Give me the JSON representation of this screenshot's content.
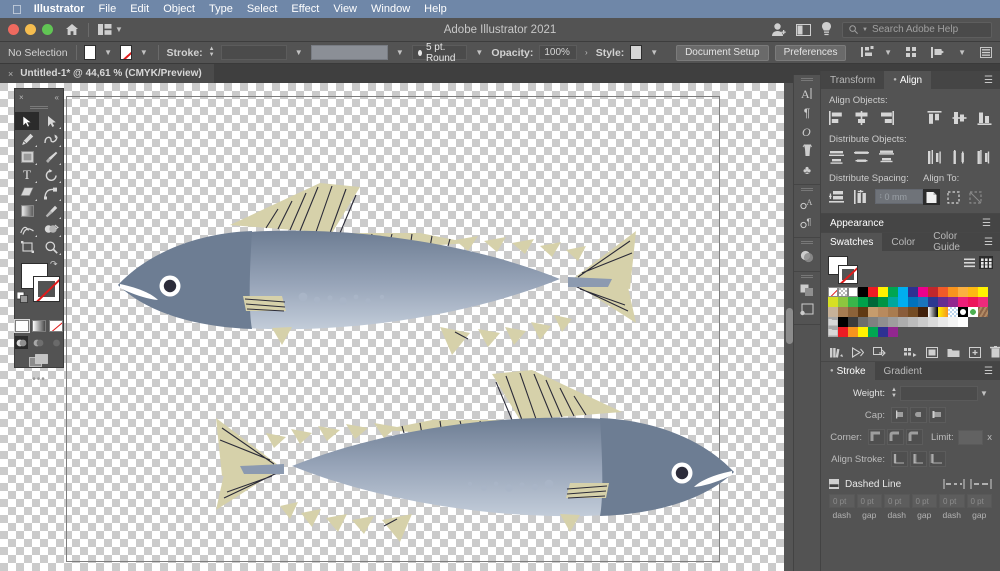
{
  "menubar": {
    "apple": "apple-logo",
    "app": "Illustrator",
    "items": [
      "File",
      "Edit",
      "Object",
      "Type",
      "Select",
      "Effect",
      "View",
      "Window",
      "Help"
    ]
  },
  "titlebar": {
    "title": "Adobe Illustrator 2021",
    "search_placeholder": "Search Adobe Help",
    "home_icon": "home-icon",
    "layout_icon": "arrange-documents-icon",
    "account_icon": "user-account-icon",
    "panel_icon": "panel-toggle-icon",
    "bulb_icon": "discover-bulb-icon"
  },
  "control_bar": {
    "selection_state": "No Selection",
    "fill_label": "fill-swatch",
    "stroke_label": "Stroke:",
    "stroke_weight": "",
    "stroke_profile": "",
    "brush_def": "5 pt. Round",
    "opacity_label": "Opacity:",
    "opacity_value": "100%",
    "style_label": "Style:",
    "document_setup": "Document Setup",
    "preferences": "Preferences",
    "align_icon": "align-options-icon"
  },
  "doc_tab": {
    "close": "×",
    "title": "Untitled-1* @ 44,61 % (CMYK/Preview)"
  },
  "toolbar": {
    "close": "×",
    "collapse": "«",
    "tools": [
      {
        "name": "selection-tool",
        "glyph": "selection-arrow",
        "active": true
      },
      {
        "name": "direct-selection-tool",
        "glyph": "direct-arrow",
        "active": false
      },
      {
        "name": "pen-tool",
        "glyph": "pen",
        "active": false
      },
      {
        "name": "curvature-tool",
        "glyph": "curvature",
        "active": false
      },
      {
        "name": "rectangle-tool",
        "glyph": "rectangle",
        "active": false
      },
      {
        "name": "paintbrush-tool",
        "glyph": "brush",
        "active": false
      },
      {
        "name": "type-tool",
        "glyph": "T",
        "active": false
      },
      {
        "name": "rotate-tool",
        "glyph": "rotate",
        "active": false
      },
      {
        "name": "eraser-tool",
        "glyph": "eraser",
        "active": false
      },
      {
        "name": "scale-tool",
        "glyph": "scale",
        "active": false
      },
      {
        "name": "gradient-tool",
        "glyph": "gradient",
        "active": false
      },
      {
        "name": "eyedropper-tool",
        "glyph": "eyedropper",
        "active": false
      },
      {
        "name": "blend-tool",
        "glyph": "blend",
        "active": false
      },
      {
        "name": "shape-builder-tool",
        "glyph": "shapebuilder",
        "active": false
      },
      {
        "name": "artboard-tool",
        "glyph": "artboard",
        "active": false
      },
      {
        "name": "zoom-tool",
        "glyph": "magnifier",
        "active": false
      }
    ],
    "fill_color": "#ffffff",
    "stroke_color": "none",
    "swap_icon": "swap-fill-stroke-icon",
    "default_icon": "default-fill-stroke-icon",
    "mini_modes": [
      "color-fill",
      "gradient-fill",
      "none-fill"
    ],
    "draw_modes": [
      "draw-normal",
      "draw-behind",
      "draw-inside"
    ],
    "screen_mode": "change-screen-mode-icon",
    "more_tools": "•••"
  },
  "panel_icons": {
    "groups": [
      [
        "character-panel-icon",
        "paragraph-panel-icon",
        "glyphs-panel-icon",
        "brushes-panel-icon",
        "symbols-panel-icon"
      ],
      [
        "character-styles-panel-icon",
        "paragraph-styles-panel-icon"
      ],
      [
        "transparency-panel-icon"
      ],
      [
        "pathfinder-panel-icon",
        "artboards-panel-icon"
      ]
    ]
  },
  "align_panel": {
    "tabs": [
      {
        "label": "Transform",
        "active": false,
        "name": "tab-transform"
      },
      {
        "label": "Align",
        "active": true,
        "name": "tab-align"
      }
    ],
    "menu_icon": "panel-menu-icon",
    "align_objects_label": "Align Objects:",
    "align_objects_buttons": [
      "horizontal-align-left",
      "horizontal-align-center",
      "horizontal-align-right",
      "vertical-align-top",
      "vertical-align-middle",
      "vertical-align-bottom"
    ],
    "distribute_objects_label": "Distribute Objects:",
    "distribute_objects_buttons": [
      "vertical-distribute-top",
      "vertical-distribute-center",
      "vertical-distribute-bottom",
      "horizontal-distribute-left",
      "horizontal-distribute-center",
      "horizontal-distribute-right"
    ],
    "distribute_spacing_label": "Distribute Spacing:",
    "distribute_spacing_buttons": [
      "vertical-distribute-space",
      "horizontal-distribute-space"
    ],
    "spacing_value": "0 mm",
    "align_to_label": "Align To:",
    "align_to_buttons": [
      "align-to-selection",
      "align-to-key-object",
      "align-to-artboard"
    ]
  },
  "appearance_panel": {
    "title": "Appearance",
    "menu_icon": "panel-menu-icon"
  },
  "swatches_panel": {
    "tabs": [
      {
        "label": "Swatches",
        "active": true,
        "name": "tab-swatches"
      },
      {
        "label": "Color",
        "active": false,
        "name": "tab-color"
      },
      {
        "label": "Color Guide",
        "active": false,
        "name": "tab-color-guide"
      }
    ],
    "menu_icon": "panel-menu-icon",
    "view_list_icon": "list-view-icon",
    "view_grid_icon": "grid-view-icon",
    "rows": [
      [
        "none",
        "registration",
        "white",
        "#000000",
        "#ed1c24",
        "#fff200",
        "#00a651",
        "#00aeef",
        "#2e3192",
        "#ec008c",
        "#c1272d",
        "#f15a29",
        "#f7941e",
        "#fbb040",
        "#fdb913",
        "#fff200"
      ],
      [
        "#d7df23",
        "#8dc63f",
        "#39b54a",
        "#00a14b",
        "#006838",
        "#009444",
        "#00a79d",
        "#00aeef",
        "#0072bc",
        "#1b75bc",
        "#2b3990",
        "#662d91",
        "#92278f",
        "#ed1e79",
        "#ed145b",
        "#ee2a7b"
      ],
      [
        "#c7b299",
        "#a67c52",
        "#8c6239",
        "#603913",
        "#c69c6d",
        "#b88a5e",
        "#a97c50",
        "#8a5d3b",
        "#754c24",
        "#42210b",
        "gradient-bw",
        "gradient-yellow",
        "pattern-dots",
        "pattern-circle",
        "pattern-leaf",
        "pattern-wood"
      ],
      [
        "folder",
        "#000000",
        "#3b3b3b",
        "#6d6d6d",
        "#808080",
        "#8f8f8f",
        "#9e9e9e",
        "#adadad",
        "#bcbcbc",
        "#cbcbcb",
        "#dadada",
        "#e9e9e9",
        "#f4f4f4",
        "#ffffff",
        "",
        ""
      ],
      [
        "folder",
        "#ed1c24",
        "#f7941e",
        "#fff200",
        "#00a651",
        "#2e3192",
        "#92278f",
        "",
        "",
        "",
        "",
        "",
        "",
        "",
        "",
        ""
      ]
    ],
    "bottom_buttons": [
      "swatch-libraries-icon",
      "show-swatch-kinds-icon",
      "swatch-options-icon",
      "new-color-group-icon",
      "new-swatch-icon",
      "folder-icon",
      "add-icon",
      "delete-icon"
    ]
  },
  "stroke_panel": {
    "tabs": [
      {
        "label": "Stroke",
        "active": true,
        "name": "tab-stroke"
      },
      {
        "label": "Gradient",
        "active": false,
        "name": "tab-gradient"
      }
    ],
    "menu_icon": "panel-menu-icon",
    "weight_label": "Weight:",
    "weight_value": "",
    "cap_label": "Cap:",
    "cap_buttons": [
      "butt-cap",
      "round-cap",
      "projecting-cap"
    ],
    "corner_label": "Corner:",
    "corner_buttons": [
      "miter-join",
      "round-join",
      "bevel-join"
    ],
    "limit_label": "Limit:",
    "limit_value": "",
    "limit_unit": "x",
    "align_stroke_label": "Align Stroke:",
    "align_stroke_buttons": [
      "align-stroke-center",
      "align-stroke-inside",
      "align-stroke-outside"
    ],
    "dashed_line_label": "Dashed Line",
    "dash_option_buttons": [
      "preserve-dash-exact",
      "preserve-dash-adjust"
    ],
    "dash_fields": [
      {
        "value": "0 pt",
        "label": "dash"
      },
      {
        "value": "0 pt",
        "label": "gap"
      },
      {
        "value": "0 pt",
        "label": "dash"
      },
      {
        "value": "0 pt",
        "label": "gap"
      },
      {
        "value": "0 pt",
        "label": "dash"
      },
      {
        "value": "0 pt",
        "label": "gap"
      }
    ]
  },
  "artwork": {
    "description": "two-mackerel-fish-vector-illustration",
    "colors": {
      "body_dark": "#6d7d93",
      "body_light": "#b9c4d4",
      "body_mid": "#8c9ab0",
      "fin_tan": "#d6d1aa",
      "fin_line": "#2b2b38",
      "eye_ring": "#ffffff",
      "eye_pupil": "#2c2c3a",
      "spot": "#a9b5c7"
    },
    "fish": [
      {
        "name": "fish-top",
        "facing": "left"
      },
      {
        "name": "fish-bottom",
        "facing": "right"
      }
    ]
  }
}
